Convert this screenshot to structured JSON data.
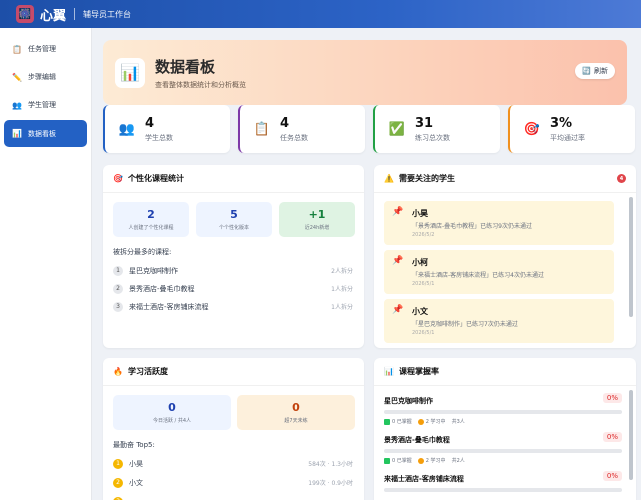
{
  "app": {
    "logo_glyph": "🎆",
    "brand": "心翼",
    "subtitle": "辅导员工作台"
  },
  "sidebar": {
    "items": [
      {
        "icon": "📋",
        "label": "任务管理"
      },
      {
        "icon": "✏️",
        "label": "步骤编辑"
      },
      {
        "icon": "👥",
        "label": "学生管理"
      },
      {
        "icon": "📊",
        "label": "数据看板"
      }
    ]
  },
  "hero": {
    "icon": "📊",
    "title": "数据看板",
    "subtitle": "查看整体数据统计和分析概览",
    "refresh_label": "刷新",
    "refresh_icon": "🔄"
  },
  "stats": [
    {
      "icon": "👥",
      "value": "4",
      "label": "学生总数",
      "accent": "#2361c4"
    },
    {
      "icon": "📋",
      "value": "4",
      "label": "任务总数",
      "accent": "#7e3aa8"
    },
    {
      "icon": "✅",
      "value": "31",
      "label": "练习总次数",
      "accent": "#22a045"
    },
    {
      "icon": "🎯",
      "value": "3%",
      "label": "平均通过率",
      "accent": "#f0901f"
    }
  ],
  "course_stats": {
    "icon": "🎯",
    "title": "个性化课程统计",
    "boxes": [
      {
        "value": "2",
        "label": "人创建了个性化课程",
        "color": "#1e40af",
        "bg": "#eef4ff"
      },
      {
        "value": "5",
        "label": "个个性化版本",
        "color": "#1e40af",
        "bg": "#eef4ff"
      },
      {
        "value": "+1",
        "label": "近24h新增",
        "color": "#15803d",
        "bg": "#dff3e3"
      }
    ],
    "section_title": "被拆分最多的课程:",
    "ranks": [
      {
        "num": "1",
        "name": "星巴克咖啡制作",
        "right": "2人拆分"
      },
      {
        "num": "2",
        "name": "景秀酒店-叠毛巾教程",
        "right": "1人拆分"
      },
      {
        "num": "3",
        "name": "来福士酒店-客房铺床流程",
        "right": "1人拆分"
      }
    ]
  },
  "attention": {
    "icon": "⚠️",
    "title": "需要关注的学生",
    "badge": "4",
    "items": [
      {
        "name": "小昊",
        "desc": "「景秀酒店-叠毛巾教程」已练习9次仍未通过",
        "date": "2026/5/2"
      },
      {
        "name": "小柯",
        "desc": "「来福士酒店-客房铺床流程」已练习4次仍未通过",
        "date": "2026/5/1"
      },
      {
        "name": "小文",
        "desc": "「星巴克咖啡制作」已练习7次仍未通过",
        "date": "2026/5/1"
      }
    ]
  },
  "activity": {
    "icon": "🔥",
    "title": "学习活跃度",
    "boxes": [
      {
        "value": "0",
        "label": "今日活跃 / 共4人",
        "color": "#1e40af",
        "bg": "#eef4ff"
      },
      {
        "value": "0",
        "label": "超7天未练",
        "color": "#c2410c",
        "bg": "#fdf0dc"
      }
    ],
    "section_title": "最勤奋 Top5:",
    "ranks": [
      {
        "num": "1",
        "name": "小昊",
        "right": "584次 · 1.3小时"
      },
      {
        "num": "2",
        "name": "小文",
        "right": "199次 · 0.9小时"
      },
      {
        "num": "3",
        "name": "",
        "right": ""
      }
    ]
  },
  "mastery": {
    "icon": "📊",
    "title": "课程掌握率",
    "items": [
      {
        "name": "星巴克咖啡制作",
        "pct": "0%",
        "mastered": "0 已掌握",
        "learning": "2 学习中",
        "total": "共3人"
      },
      {
        "name": "景秀酒店-叠毛巾教程",
        "pct": "0%",
        "mastered": "0 已掌握",
        "learning": "2 学习中",
        "total": "共2人"
      },
      {
        "name": "来福士酒店-客房铺床流程",
        "pct": "0%",
        "mastered": "",
        "learning": "",
        "total": ""
      }
    ]
  }
}
